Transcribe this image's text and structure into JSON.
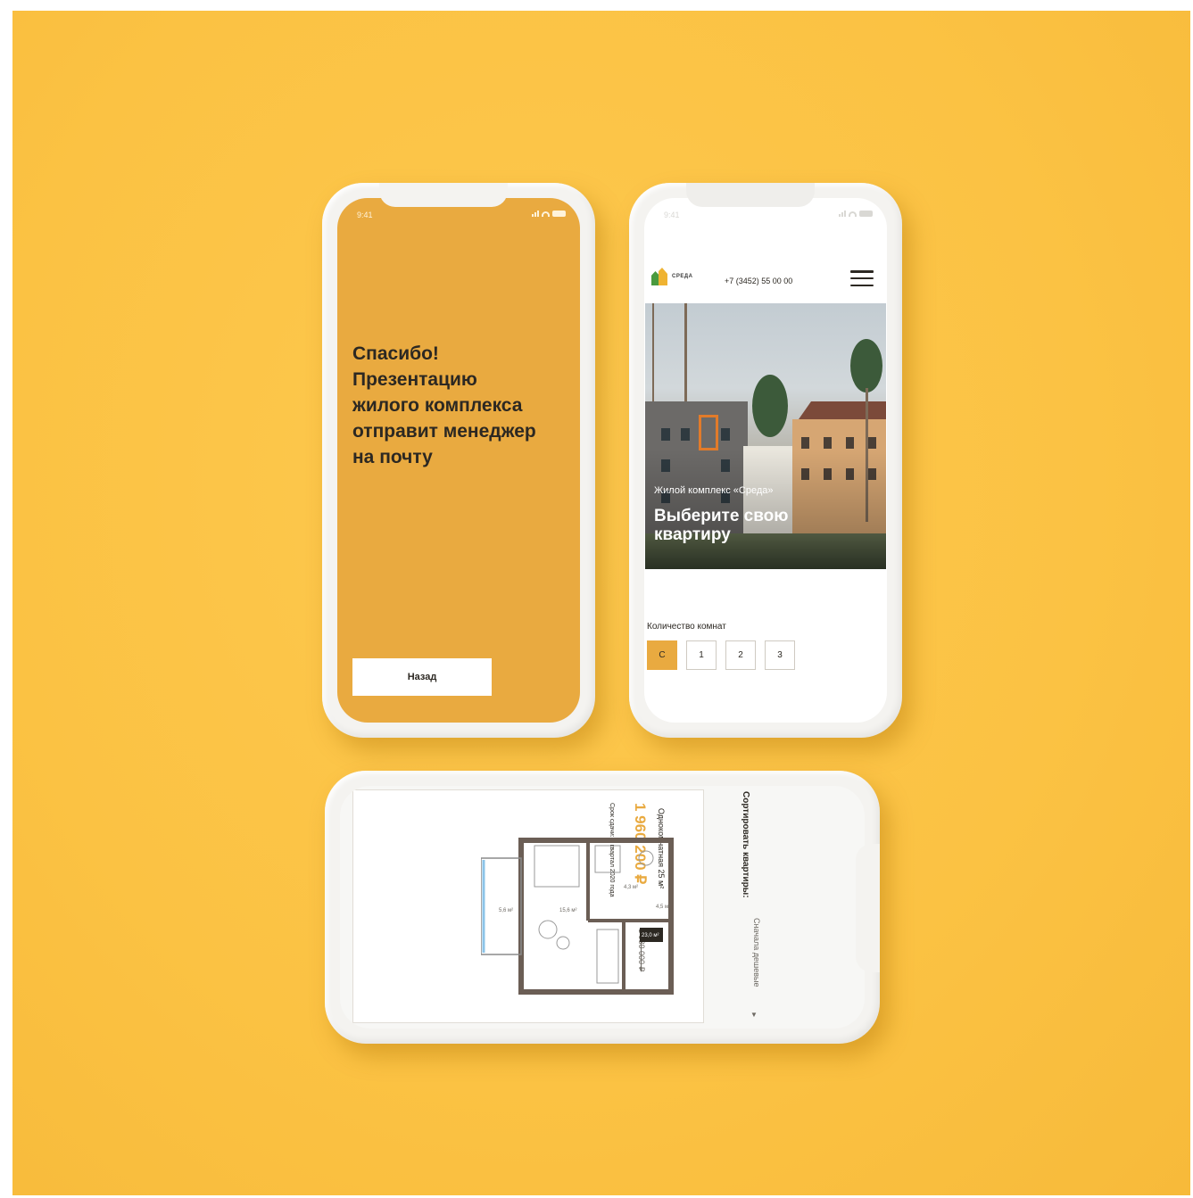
{
  "phone1": {
    "status_time": "9:41",
    "thanks_message": "Спасибо!\nПрезентацию\nжилого комплекса\nотправит менеджер\nна почту",
    "back_label": "Назад",
    "colors": {
      "accent": "#e9aa40"
    }
  },
  "phone2": {
    "status_time": "9:41",
    "logo_text": "СРЕДА",
    "phone_number": "+7 (3452) 55 00 00",
    "hero_subtitle": "Жилой комплекс «Среда»",
    "hero_title": "Выберите свою квартиру",
    "rooms_label": "Количество комнат",
    "room_options": [
      {
        "label": "С",
        "selected": true
      },
      {
        "label": "1",
        "selected": false
      },
      {
        "label": "2",
        "selected": false
      },
      {
        "label": "3",
        "selected": false
      }
    ]
  },
  "phone3": {
    "sort_label": "Сортировать квартиры:",
    "sort_value": "Сначала дешевые",
    "card": {
      "type": "Однокомнатная 25 м²",
      "price": "1 960 200 ₽",
      "old_price": "1 980 000 ₽",
      "deadline": "Срок сдачи: 4 квартал 2020 года",
      "plan_labels": [
        "15,6 м²",
        "5,6 м²",
        "4,5 м²",
        "4,3 м²",
        "23,0 м²"
      ]
    }
  },
  "icons": [
    "signal-icon",
    "wifi-icon",
    "battery-icon",
    "menu-icon",
    "logo-icon",
    "chevron-down-icon"
  ]
}
